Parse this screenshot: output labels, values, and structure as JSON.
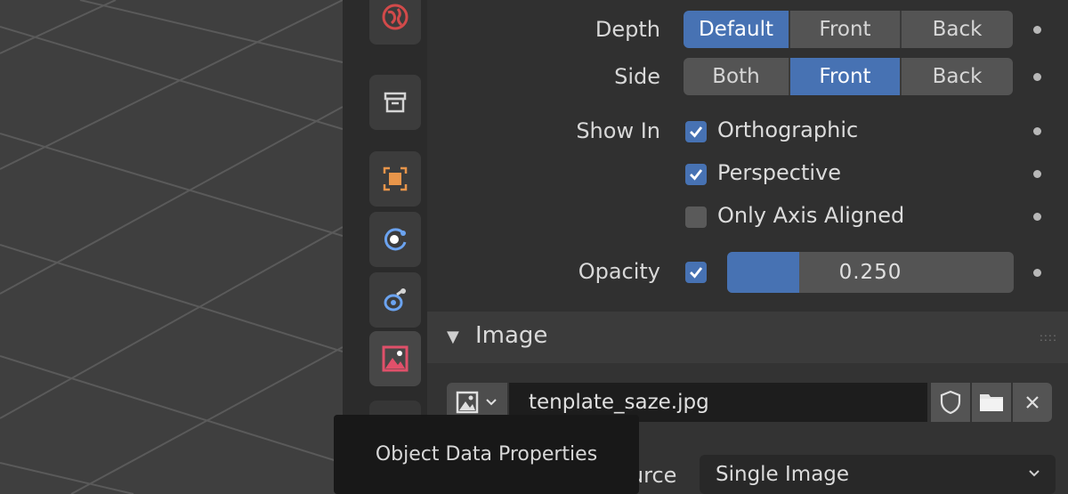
{
  "depth": {
    "label": "Depth",
    "options": [
      "Default",
      "Front",
      "Back"
    ],
    "selected": "Default"
  },
  "side": {
    "label": "Side",
    "options": [
      "Both",
      "Front",
      "Back"
    ],
    "selected": "Front"
  },
  "show_in": {
    "label": "Show In",
    "orthographic": {
      "label": "Orthographic",
      "checked": true
    },
    "perspective": {
      "label": "Perspective",
      "checked": true
    },
    "only_axis_aligned": {
      "label": "Only Axis Aligned",
      "checked": false
    }
  },
  "opacity": {
    "label": "Opacity",
    "enabled": true,
    "value": "0.250",
    "fraction": 0.25
  },
  "image_panel": {
    "title": "Image",
    "filename": "tenplate_saze.jpg",
    "source_label": "Source",
    "source_value": "Single Image"
  },
  "tooltip": "Object Data Properties",
  "colors": {
    "accent": "#4772b3",
    "panel_bg": "#303030",
    "tab_bar": "#2b2b2b",
    "viewport": "#3f3f3f",
    "world_icon": "#d24a4a",
    "object_icon": "#e8954a",
    "physics_icon": "#6ba3f0",
    "image_icon": "#e0506a"
  },
  "tabs": [
    {
      "name": "world-properties-tab",
      "icon": "world-icon"
    },
    {
      "name": "collection-properties-tab",
      "icon": "box-icon"
    },
    {
      "name": "object-properties-tab",
      "icon": "object-icon"
    },
    {
      "name": "physics-properties-tab",
      "icon": "physics-icon"
    },
    {
      "name": "constraints-properties-tab",
      "icon": "constraint-icon"
    },
    {
      "name": "object-data-properties-tab",
      "icon": "image-data-icon",
      "active": true
    }
  ]
}
